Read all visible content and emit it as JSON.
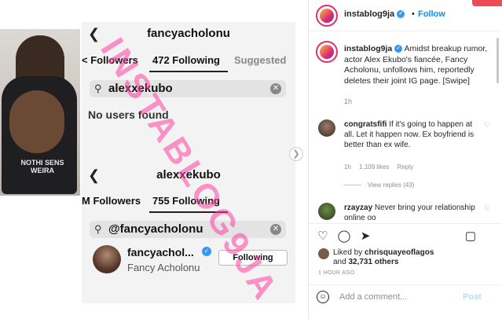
{
  "post": {
    "author": "instablog9ja",
    "verified_badge": "✓",
    "dot": "•",
    "follow_label": "Follow",
    "caption": "Amidst breakup rumor, actor Alex Ekubo's fiancée, Fancy Acholonu, unfollows him, reportedly deletes their joint IG page. [Swipe]",
    "caption_age": "1h",
    "liked_by_prefix": "Liked by",
    "liked_by_user": "chrisquayeoflagos",
    "liked_by_and": "and",
    "liked_by_count": "32,731 others",
    "posted_ago": "1 HOUR AGO",
    "add_comment_placeholder": "Add a comment...",
    "post_button": "Post"
  },
  "comments": [
    {
      "user": "congratsfifi",
      "text": "If it's going to happen at all. Let it happen now. Ex boyfriend is better than ex wife.",
      "age": "1h",
      "likes": "1,109 likes",
      "reply": "Reply",
      "view_replies": "View replies (43)"
    },
    {
      "user": "rzayzay",
      "text": "Never bring your relationship online oo"
    }
  ],
  "screenshot": {
    "top": {
      "username": "fancyacholonu",
      "tab_left": "< Followers",
      "tab_active": "472 Following",
      "tab_right": "Suggested",
      "search_query": "alexxekubo",
      "empty_message": "No users found"
    },
    "bottom": {
      "username": "alexxekubo",
      "tab_left": "M Followers",
      "tab_active": "755 Following",
      "search_query": "@fancyacholonu",
      "result_name": "fancyachol...",
      "result_fullname": "Fancy Acholonu",
      "result_button": "Following"
    },
    "watermark": "INSTABLOG9JA",
    "photo_shirt_text": "NOTHI SENS WEIRA"
  },
  "icons": {
    "back": "❮",
    "search": "⚲",
    "clear": "✕",
    "next": "❯",
    "heart": "♡",
    "comment": "◯",
    "share": "➤",
    "save": "▢",
    "smile": "☺"
  },
  "colors": {
    "accent_blue": "#0095f6",
    "watermark_pink": "#ff40a0",
    "notification_red": "#ed4956"
  }
}
